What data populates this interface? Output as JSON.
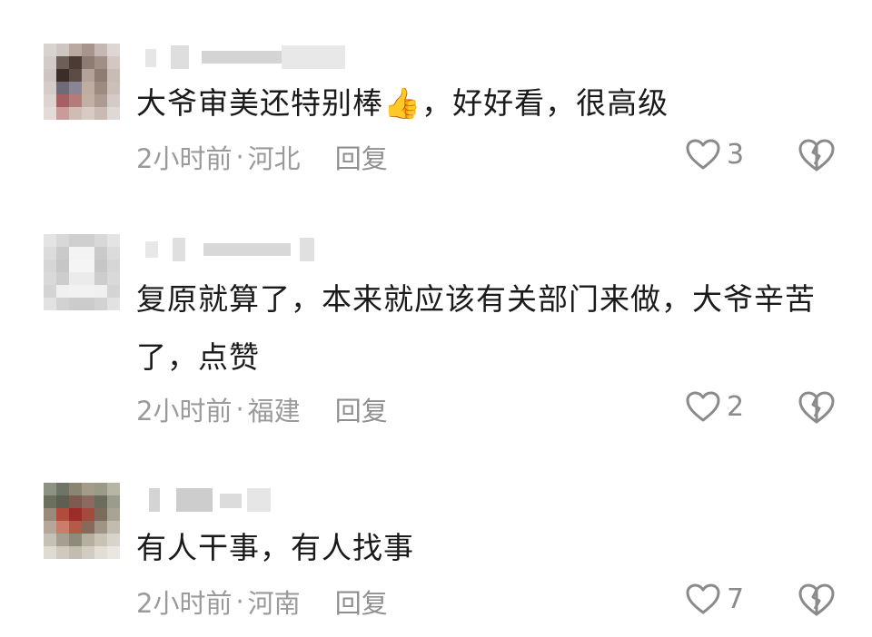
{
  "comments": [
    {
      "text": "大爷审美还特别棒👍，好好看，很高级",
      "time": "2小时前",
      "location": "河北",
      "reply_label": "回复",
      "likes": "3"
    },
    {
      "text": "复原就算了，本来就应该有关部门来做，大爷辛苦了，点赞",
      "time": "2小时前",
      "location": "福建",
      "reply_label": "回复",
      "likes": "2"
    },
    {
      "text": "有人干事，有人找事",
      "time": "2小时前",
      "location": "河南",
      "reply_label": "回复",
      "likes": "7"
    }
  ],
  "meta_separator": "·",
  "icons": {
    "like": "heart-outline-icon",
    "dislike": "broken-heart-icon"
  },
  "colors": {
    "text": "#1a1a1a",
    "meta": "#9a9a9a",
    "icon": "#8a8a8a"
  }
}
